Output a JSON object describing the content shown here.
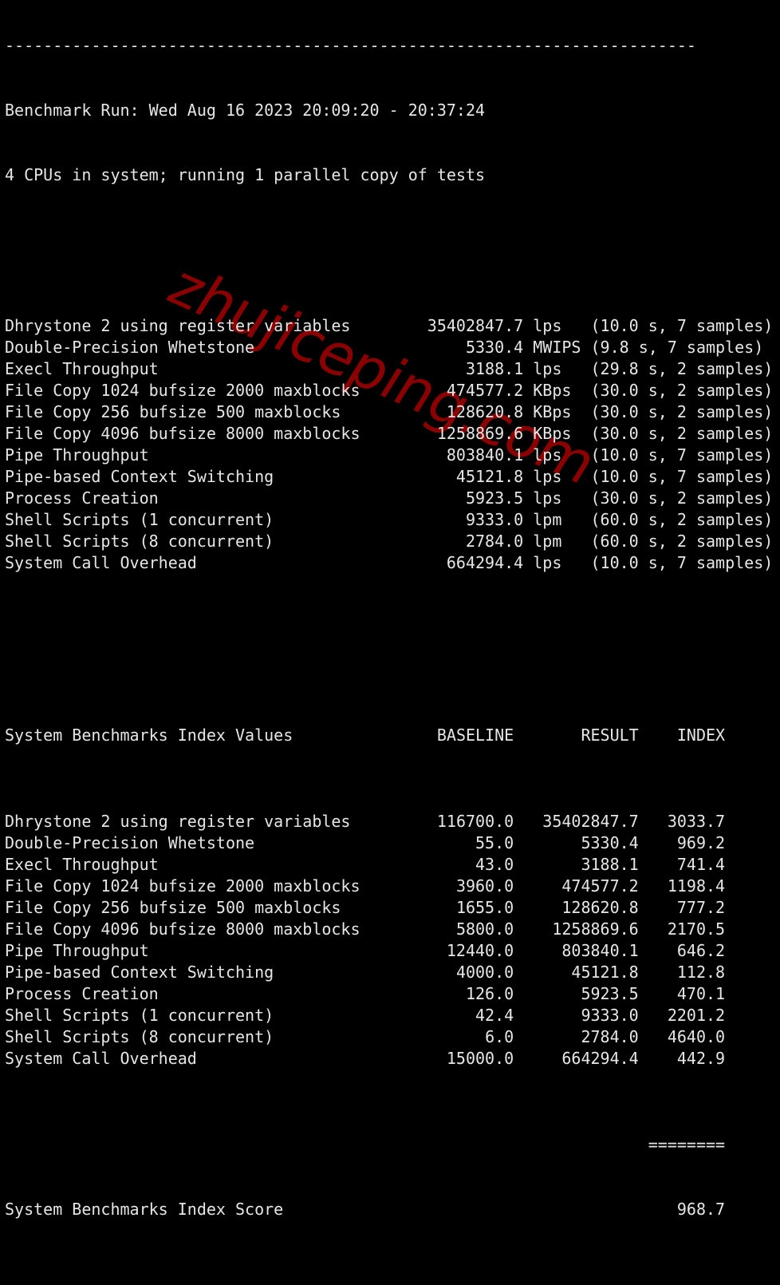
{
  "watermark": "zhujiceping.com",
  "colors": {
    "background": "#000000",
    "text": "#e6e6e6",
    "watermark": "#8b0000"
  },
  "header": {
    "separator": "------------------------------------------------------------------------",
    "run_line": "Benchmark Run: Wed Aug 16 2023 20:09:20 - 20:37:24",
    "cpu_line": "4 CPUs in system; running 1 parallel copy of tests"
  },
  "results": [
    {
      "name": "Dhrystone 2 using register variables",
      "value": "35402847.7",
      "unit": "lps",
      "detail": "(10.0 s, 7 samples)"
    },
    {
      "name": "Double-Precision Whetstone",
      "value": "5330.4",
      "unit": "MWIPS",
      "detail": "(9.8 s, 7 samples)"
    },
    {
      "name": "Execl Throughput",
      "value": "3188.1",
      "unit": "lps",
      "detail": "(29.8 s, 2 samples)"
    },
    {
      "name": "File Copy 1024 bufsize 2000 maxblocks",
      "value": "474577.2",
      "unit": "KBps",
      "detail": "(30.0 s, 2 samples)"
    },
    {
      "name": "File Copy 256 bufsize 500 maxblocks",
      "value": "128620.8",
      "unit": "KBps",
      "detail": "(30.0 s, 2 samples)"
    },
    {
      "name": "File Copy 4096 bufsize 8000 maxblocks",
      "value": "1258869.6",
      "unit": "KBps",
      "detail": "(30.0 s, 2 samples)"
    },
    {
      "name": "Pipe Throughput",
      "value": "803840.1",
      "unit": "lps",
      "detail": "(10.0 s, 7 samples)"
    },
    {
      "name": "Pipe-based Context Switching",
      "value": "45121.8",
      "unit": "lps",
      "detail": "(10.0 s, 7 samples)"
    },
    {
      "name": "Process Creation",
      "value": "5923.5",
      "unit": "lps",
      "detail": "(30.0 s, 2 samples)"
    },
    {
      "name": "Shell Scripts (1 concurrent)",
      "value": "9333.0",
      "unit": "lpm",
      "detail": "(60.0 s, 2 samples)"
    },
    {
      "name": "Shell Scripts (8 concurrent)",
      "value": "2784.0",
      "unit": "lpm",
      "detail": "(60.0 s, 2 samples)"
    },
    {
      "name": "System Call Overhead",
      "value": "664294.4",
      "unit": "lps",
      "detail": "(10.0 s, 7 samples)"
    }
  ],
  "index_table": {
    "title": "System Benchmarks Index Values",
    "columns": [
      "BASELINE",
      "RESULT",
      "INDEX"
    ],
    "rows": [
      {
        "name": "Dhrystone 2 using register variables",
        "baseline": "116700.0",
        "result": "35402847.7",
        "index": "3033.7"
      },
      {
        "name": "Double-Precision Whetstone",
        "baseline": "55.0",
        "result": "5330.4",
        "index": "969.2"
      },
      {
        "name": "Execl Throughput",
        "baseline": "43.0",
        "result": "3188.1",
        "index": "741.4"
      },
      {
        "name": "File Copy 1024 bufsize 2000 maxblocks",
        "baseline": "3960.0",
        "result": "474577.2",
        "index": "1198.4"
      },
      {
        "name": "File Copy 256 bufsize 500 maxblocks",
        "baseline": "1655.0",
        "result": "128620.8",
        "index": "777.2"
      },
      {
        "name": "File Copy 4096 bufsize 8000 maxblocks",
        "baseline": "5800.0",
        "result": "1258869.6",
        "index": "2170.5"
      },
      {
        "name": "Pipe Throughput",
        "baseline": "12440.0",
        "result": "803840.1",
        "index": "646.2"
      },
      {
        "name": "Pipe-based Context Switching",
        "baseline": "4000.0",
        "result": "45121.8",
        "index": "112.8"
      },
      {
        "name": "Process Creation",
        "baseline": "126.0",
        "result": "5923.5",
        "index": "470.1"
      },
      {
        "name": "Shell Scripts (1 concurrent)",
        "baseline": "42.4",
        "result": "9333.0",
        "index": "2201.2"
      },
      {
        "name": "Shell Scripts (8 concurrent)",
        "baseline": "6.0",
        "result": "2784.0",
        "index": "4640.0"
      },
      {
        "name": "System Call Overhead",
        "baseline": "15000.0",
        "result": "664294.4",
        "index": "442.9"
      }
    ],
    "score_separator": "========",
    "score_label": "System Benchmarks Index Score",
    "score_value": "968.7"
  }
}
